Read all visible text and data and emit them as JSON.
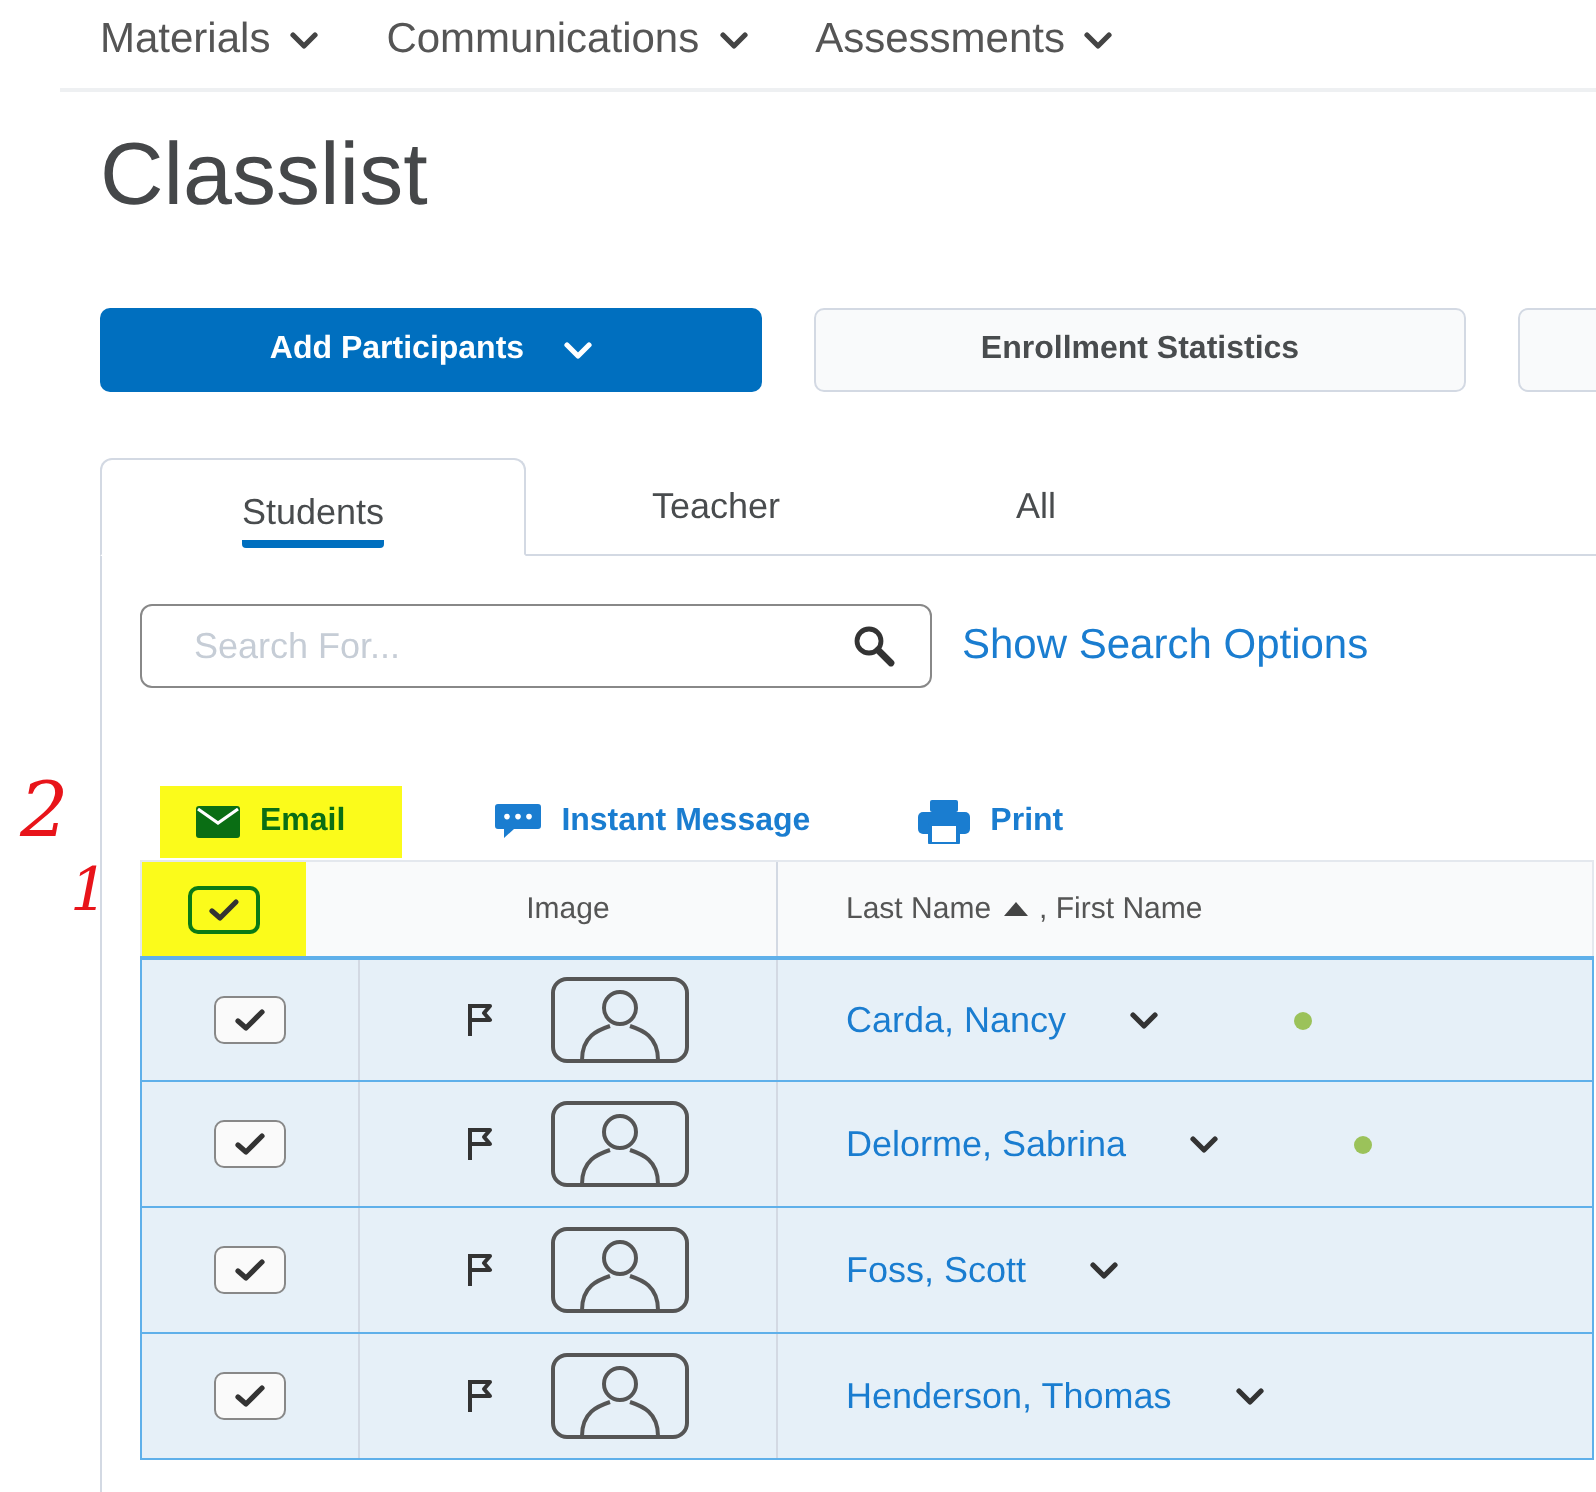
{
  "nav": [
    {
      "label": "Materials"
    },
    {
      "label": "Communications"
    },
    {
      "label": "Assessments"
    }
  ],
  "title": "Classlist",
  "buttons": [
    {
      "label": "Add Participants",
      "kind": "primary"
    },
    {
      "label": "Enrollment Statistics",
      "kind": "secondary"
    },
    {
      "kind": "secondary"
    }
  ],
  "tabs": [
    {
      "label": "Students",
      "selected": true
    },
    {
      "label": "Teacher",
      "selected": false
    },
    {
      "label": "All",
      "selected": false
    }
  ],
  "search": {
    "placeholder": "Search For...",
    "link": "Show Search Options"
  },
  "actions": [
    {
      "label": "Email",
      "kind": "email",
      "highlighted": true
    },
    {
      "label": "Instant Message",
      "kind": "message",
      "highlighted": false
    },
    {
      "label": "Print",
      "kind": "print",
      "highlighted": false
    }
  ],
  "table": {
    "select_all": {
      "checked": true,
      "highlighted": true
    },
    "columns": [
      {
        "label": "Image"
      },
      {
        "label": "Last Name",
        "sort_ascending": true,
        "suffix": ", First Name"
      }
    ],
    "rows": [
      {
        "name": "Carda, Nancy",
        "checked": true,
        "selected": true,
        "online": true
      },
      {
        "name": "Delorme, Sabrina",
        "checked": true,
        "selected": true,
        "online": true
      },
      {
        "name": "Foss, Scott",
        "checked": true,
        "selected": true,
        "online": false
      },
      {
        "name": "Henderson, Thomas",
        "checked": true,
        "selected": true,
        "online": false
      }
    ]
  },
  "annotations": [
    {
      "text": "2"
    },
    {
      "text": "1"
    }
  ]
}
